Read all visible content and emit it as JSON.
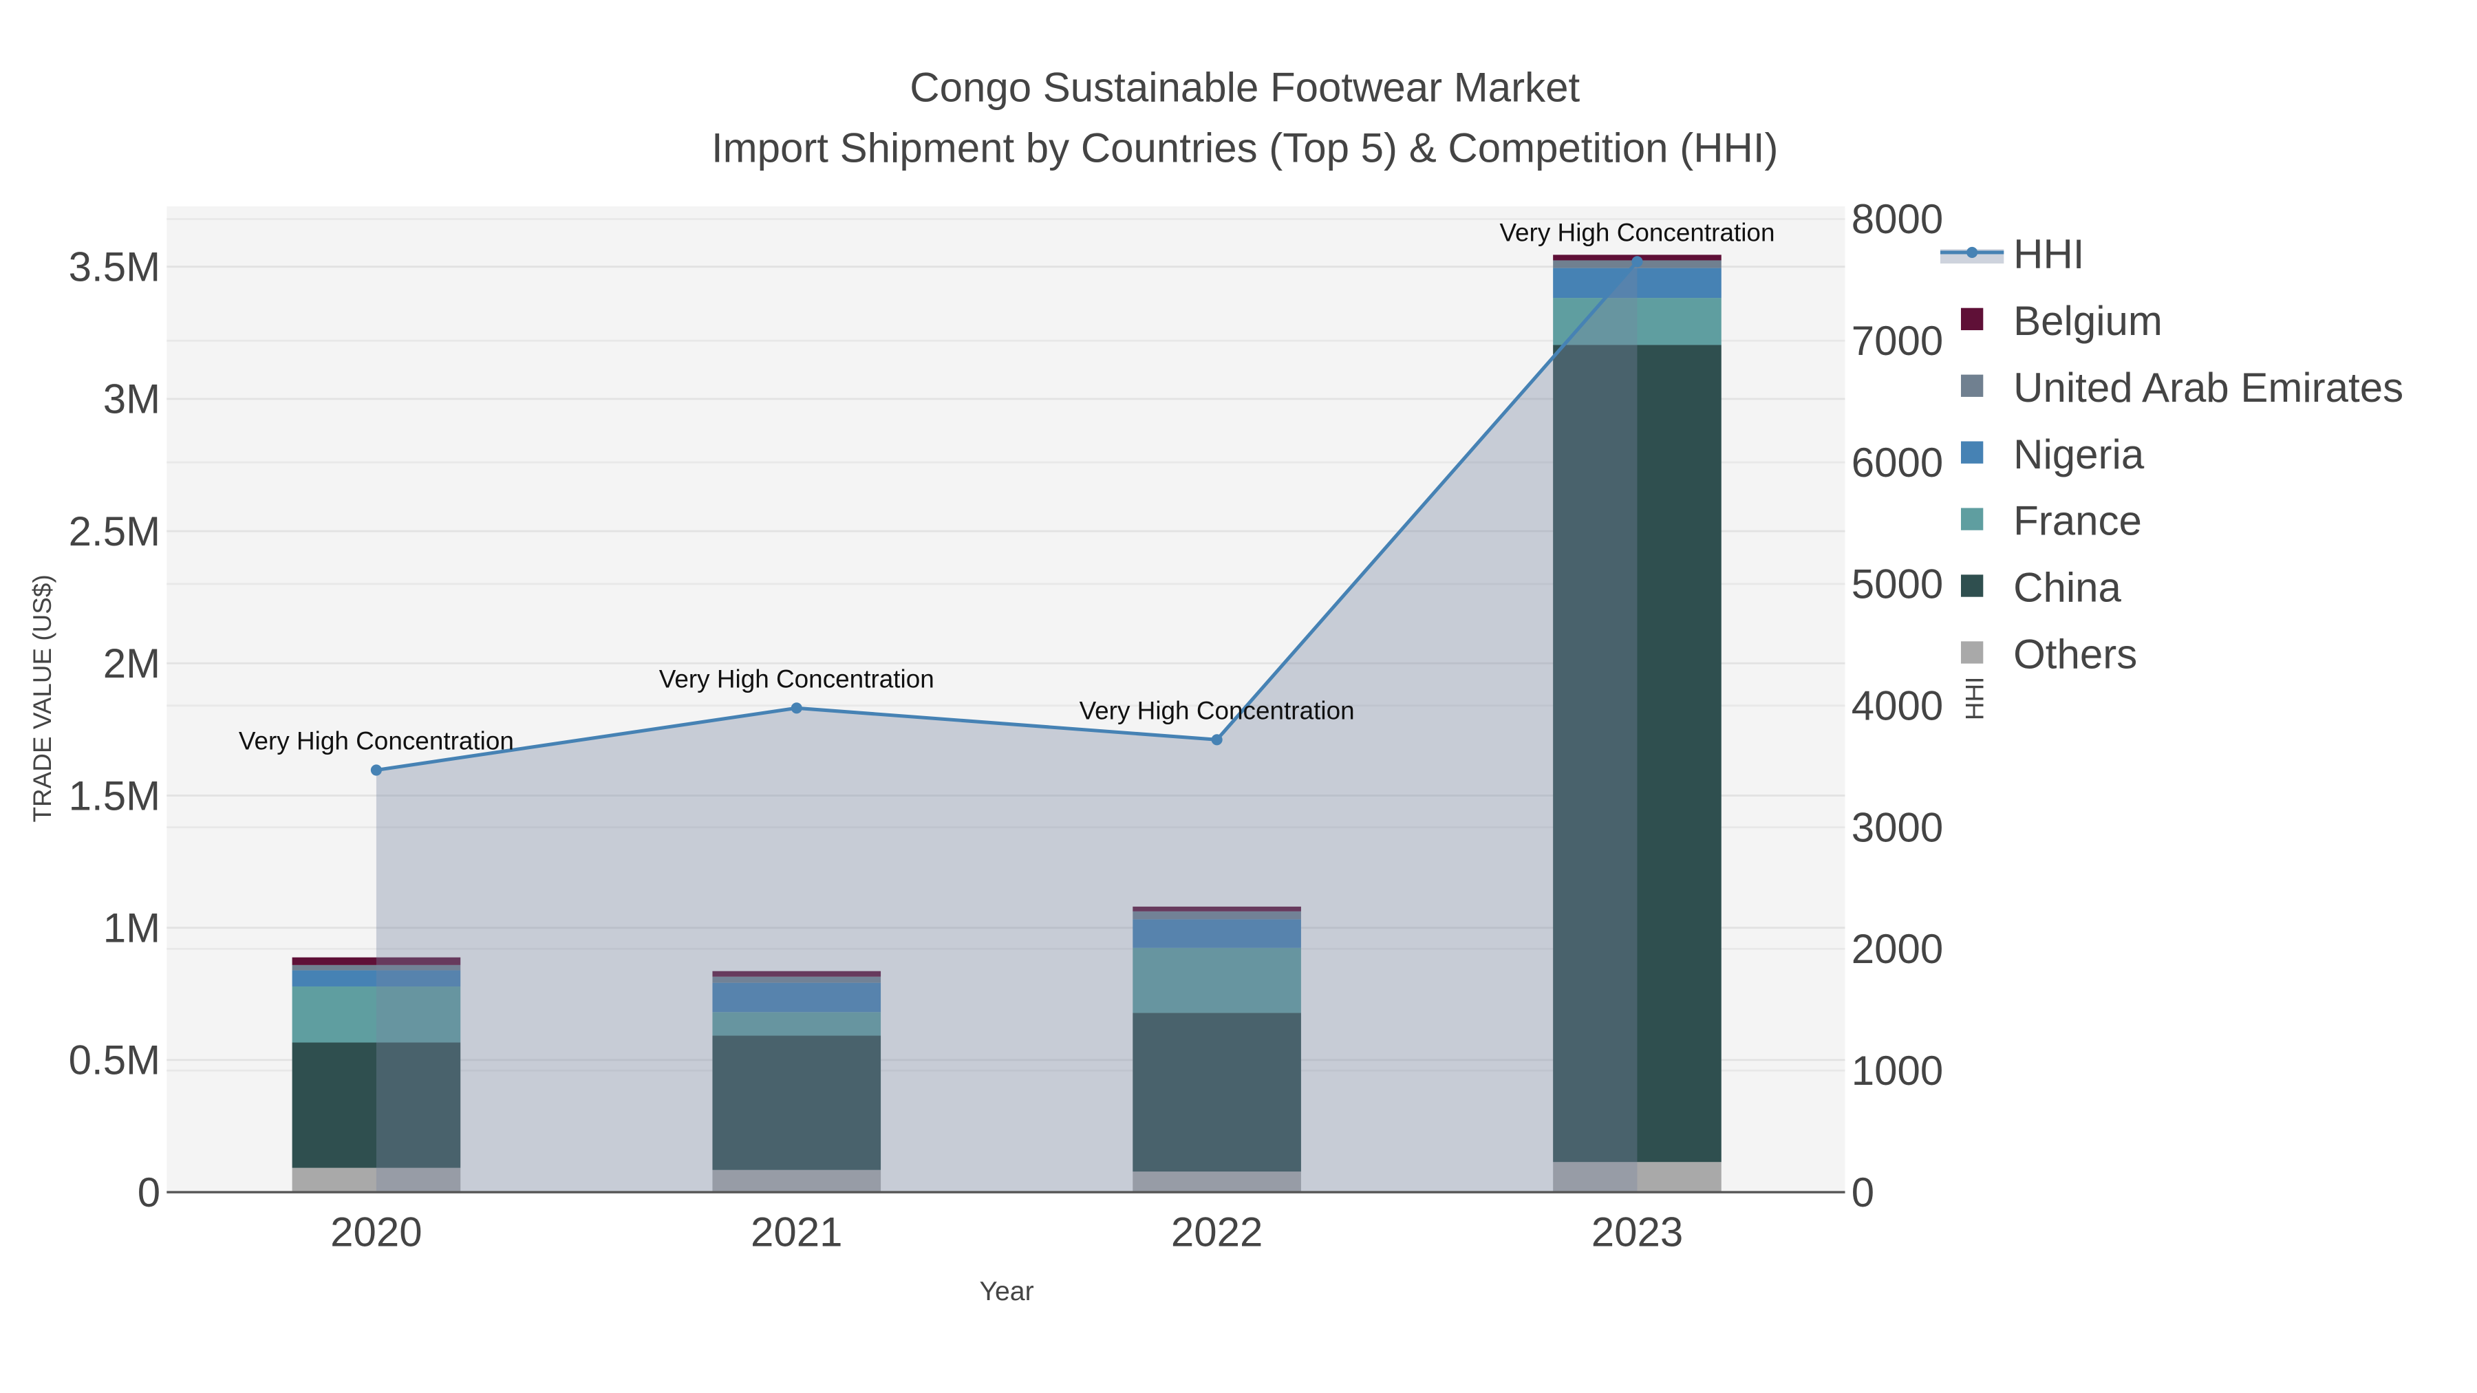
{
  "chart_data": {
    "type": "bar",
    "title": "Congo Sustainable Footwear Market",
    "subtitle": "Import Shipment by Countries (Top 5) & Competition (HHI)",
    "xlabel": "Year",
    "ylabel": "TRADE VALUE (US$)",
    "y2label": "HHI",
    "categories": [
      "2020",
      "2021",
      "2022",
      "2023"
    ],
    "ylim": [
      0,
      3700000
    ],
    "y2lim": [
      0,
      8100
    ],
    "yticks": [
      {
        "v": 0,
        "label": "0"
      },
      {
        "v": 500000,
        "label": "0.5M"
      },
      {
        "v": 1000000,
        "label": "1M"
      },
      {
        "v": 1500000,
        "label": "1.5M"
      },
      {
        "v": 2000000,
        "label": "2M"
      },
      {
        "v": 2500000,
        "label": "2.5M"
      },
      {
        "v": 3000000,
        "label": "3M"
      },
      {
        "v": 3500000,
        "label": "3.5M"
      }
    ],
    "y2ticks": [
      {
        "v": 0,
        "label": "0"
      },
      {
        "v": 1000,
        "label": "1000"
      },
      {
        "v": 2000,
        "label": "2000"
      },
      {
        "v": 3000,
        "label": "3000"
      },
      {
        "v": 4000,
        "label": "4000"
      },
      {
        "v": 5000,
        "label": "5000"
      },
      {
        "v": 6000,
        "label": "6000"
      },
      {
        "v": 7000,
        "label": "7000"
      },
      {
        "v": 8000,
        "label": "8000"
      }
    ],
    "series": [
      {
        "name": "Others",
        "color": "#a9a9a9",
        "values": [
          92000,
          84000,
          78000,
          114000
        ]
      },
      {
        "name": "China",
        "color": "#2f4f4f",
        "values": [
          474000,
          508000,
          600000,
          3090000
        ]
      },
      {
        "name": "France",
        "color": "#5f9ea0",
        "values": [
          212000,
          89000,
          246000,
          178000
        ]
      },
      {
        "name": "Nigeria",
        "color": "#4682b4",
        "values": [
          61000,
          111000,
          108000,
          113000
        ]
      },
      {
        "name": "United Arab Emirates",
        "color": "#708090",
        "values": [
          20000,
          23000,
          30000,
          29000
        ]
      },
      {
        "name": "Belgium",
        "color": "#5f1037",
        "values": [
          29000,
          21000,
          18000,
          21000
        ]
      }
    ],
    "line": {
      "name": "HHI",
      "color": "#4682b4",
      "axis": "right",
      "values": [
        3470,
        3980,
        3720,
        7650
      ],
      "annotations": [
        "Very High Concentration",
        "Very High Concentration",
        "Very High Concentration",
        "Very High Concentration"
      ]
    },
    "legend": {
      "placement": "right",
      "order": [
        "HHI",
        "Belgium",
        "United Arab Emirates",
        "Nigeria",
        "France",
        "China",
        "Others"
      ]
    },
    "grid": true
  }
}
